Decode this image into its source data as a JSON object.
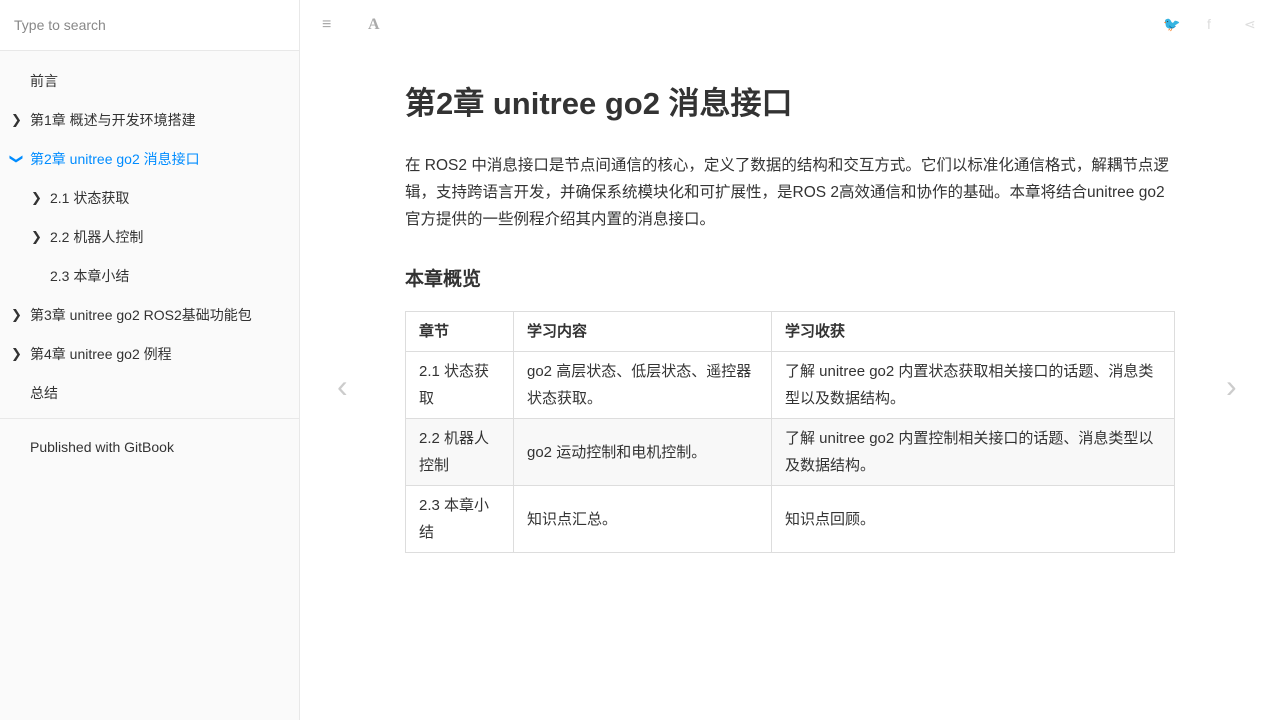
{
  "sidebar": {
    "search_placeholder": "Type to search",
    "items": [
      {
        "label": "前言",
        "level": 1,
        "chevron": ""
      },
      {
        "label": "第1章 概述与开发环境搭建",
        "level": 1,
        "chevron": "›"
      },
      {
        "label": "第2章 unitree go2 消息接口",
        "level": 1,
        "chevron": "⌄",
        "active": true
      },
      {
        "label": "2.1 状态获取",
        "level": 2,
        "chevron": "›"
      },
      {
        "label": "2.2 机器人控制",
        "level": 2,
        "chevron": "›"
      },
      {
        "label": "2.3 本章小结",
        "level": 2,
        "chevron": ""
      },
      {
        "label": "第3章 unitree go2 ROS2基础功能包",
        "level": 1,
        "chevron": "›"
      },
      {
        "label": "第4章 unitree go2 例程",
        "level": 1,
        "chevron": "›"
      },
      {
        "label": "总结",
        "level": 1,
        "chevron": ""
      }
    ],
    "published": "Published with GitBook"
  },
  "page": {
    "title": "第2章 unitree go2 消息接口",
    "intro": "在 ROS2 中消息接口是节点间通信的核心，定义了数据的结构和交互方式。它们以标准化通信格式，解耦节点逻辑，支持跨语言开发，并确保系统模块化和可扩展性，是ROS 2高效通信和协作的基础。本章将结合unitree go2 官方提供的一些例程介绍其内置的消息接口。",
    "overview_heading": "本章概览",
    "table": {
      "headers": [
        "章节",
        "学习内容",
        "学习收获"
      ],
      "rows": [
        [
          "2.1 状态获取",
          "go2 高层状态、低层状态、遥控器状态获取。",
          "了解 unitree go2 内置状态获取相关接口的话题、消息类型以及数据结构。"
        ],
        [
          "2.2 机器人控制",
          "go2 运动控制和电机控制。",
          "了解 unitree go2 内置控制相关接口的话题、消息类型以及数据结构。"
        ],
        [
          "2.3 本章小结",
          "知识点汇总。",
          "知识点回顾。"
        ]
      ]
    }
  }
}
